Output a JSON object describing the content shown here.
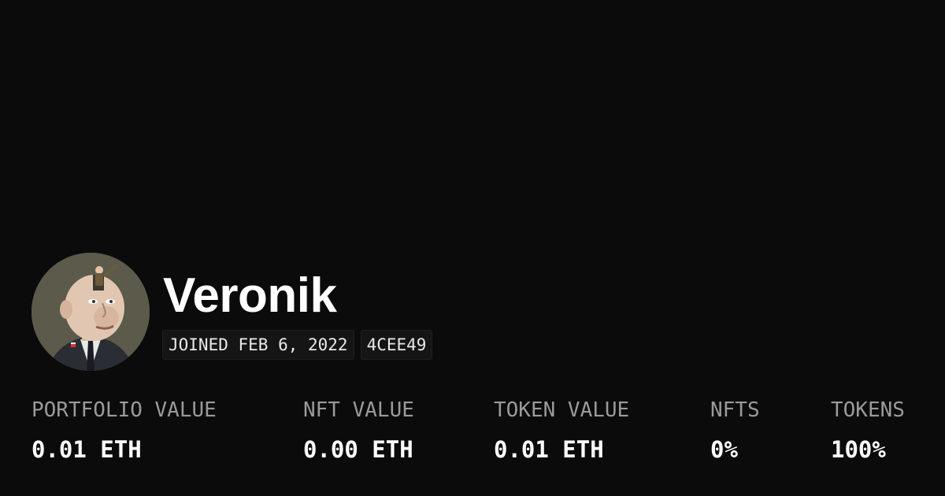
{
  "profile": {
    "name": "Veronik",
    "joined": "JOINED FEB 6, 2022",
    "color_tag": "4CEE49",
    "avatar_icon": "cartoon-portrait-avatar"
  },
  "stats": [
    {
      "label": "PORTFOLIO VALUE",
      "value": "0.01 ETH"
    },
    {
      "label": "NFT VALUE",
      "value": "0.00 ETH"
    },
    {
      "label": "TOKEN VALUE",
      "value": "0.01 ETH"
    },
    {
      "label": "NFTS",
      "value": "0%"
    },
    {
      "label": "TOKENS",
      "value": "100%"
    }
  ],
  "colors": {
    "background": "#0b0b0b",
    "text": "#ffffff",
    "muted": "#9a9a9a",
    "tag_bg": "#151515"
  }
}
